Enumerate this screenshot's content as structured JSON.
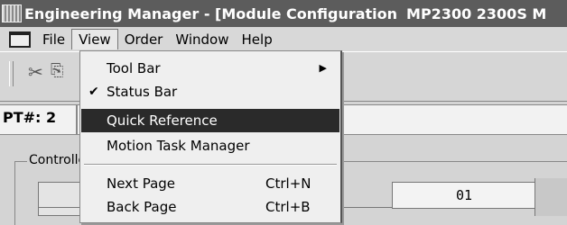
{
  "window": {
    "title": "Engineering Manager - [Module Configuration",
    "title_extra": "MP2300 2300S M"
  },
  "menubar": {
    "items": [
      "File",
      "View",
      "Order",
      "Window",
      "Help"
    ]
  },
  "toolbar": {
    "icons": [
      "cut-icon",
      "copy-icon"
    ]
  },
  "pt_row": {
    "label": "PT#: 2"
  },
  "content": {
    "group_label": "Controller",
    "column_header": "01"
  },
  "view_menu": {
    "items": [
      {
        "label": "Tool Bar",
        "submenu": true
      },
      {
        "label": "Status Bar",
        "checked": true
      },
      {
        "label": "Quick Reference",
        "highlighted": true
      },
      {
        "label": "Motion Task Manager"
      },
      {
        "label": "Next Page",
        "shortcut": "Ctrl+N"
      },
      {
        "label": "Back Page",
        "shortcut": "Ctrl+B"
      }
    ],
    "arrow": "▶",
    "check": "✔"
  }
}
